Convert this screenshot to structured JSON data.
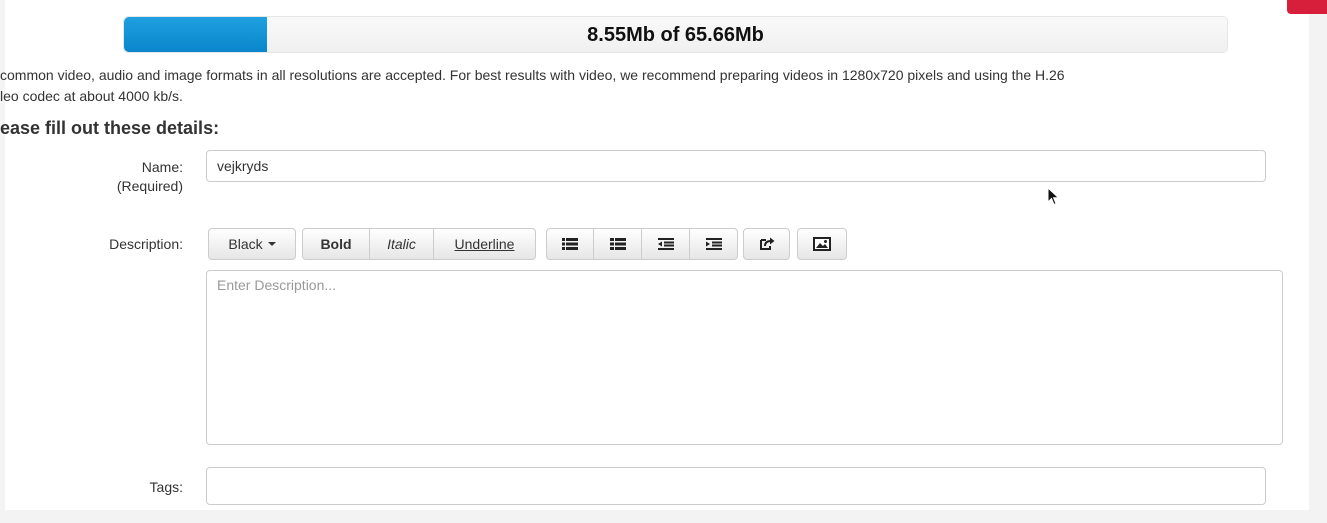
{
  "upload": {
    "progress_text": "8.55Mb of 65.66Mb",
    "progress_fraction": 0.13,
    "fill_color": "#0d8fd6"
  },
  "info": {
    "line1": " common video, audio and image formats in all resolutions are accepted. For best results with video, we recommend preparing videos in 1280x720 pixels and using the H.26",
    "line2": "leo codec at about 4000 kb/s."
  },
  "form": {
    "section_title": "ease fill out these details:",
    "name": {
      "label": "Name:",
      "required_note": "(Required)",
      "value": "vejkryds"
    },
    "description": {
      "label": "Description:",
      "placeholder": "Enter Description..."
    },
    "tags": {
      "label": "Tags:",
      "value": ""
    }
  },
  "toolbar": {
    "color_label": "Black",
    "bold_label": "Bold",
    "italic_label": "Italic",
    "underline_label": "Underline",
    "icons": [
      "bullet-list-icon",
      "numbered-list-icon",
      "outdent-icon",
      "indent-icon",
      "link-icon",
      "image-icon"
    ]
  },
  "accent_color": "#d71f3b"
}
